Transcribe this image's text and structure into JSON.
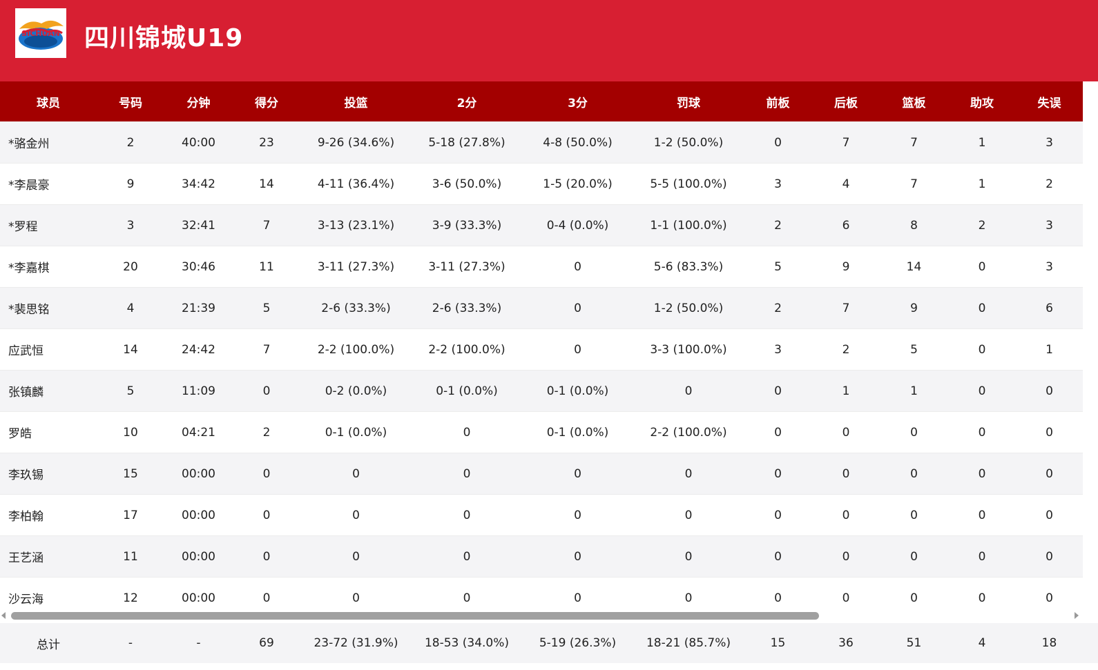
{
  "team": {
    "name": "四川锦城U19",
    "logo_text": "SICHUAN"
  },
  "colors": {
    "header_bg": "#d71f32",
    "table_header_bg": "#a30000",
    "row_alt_bg": "#f4f4f6"
  },
  "columns": [
    "球员",
    "号码",
    "分钟",
    "得分",
    "投篮",
    "2分",
    "3分",
    "罚球",
    "前板",
    "后板",
    "篮板",
    "助攻",
    "失误"
  ],
  "rows": [
    {
      "player": "*骆金州",
      "number": "2",
      "minutes": "40:00",
      "points": "23",
      "fg": "9-26 (34.6%)",
      "two": "5-18 (27.8%)",
      "three": "4-8 (50.0%)",
      "ft": "1-2 (50.0%)",
      "oreb": "0",
      "dreb": "7",
      "reb": "7",
      "ast": "1",
      "tov": "3"
    },
    {
      "player": "*李晨豪",
      "number": "9",
      "minutes": "34:42",
      "points": "14",
      "fg": "4-11 (36.4%)",
      "two": "3-6 (50.0%)",
      "three": "1-5 (20.0%)",
      "ft": "5-5 (100.0%)",
      "oreb": "3",
      "dreb": "4",
      "reb": "7",
      "ast": "1",
      "tov": "2"
    },
    {
      "player": "*罗程",
      "number": "3",
      "minutes": "32:41",
      "points": "7",
      "fg": "3-13 (23.1%)",
      "two": "3-9 (33.3%)",
      "three": "0-4 (0.0%)",
      "ft": "1-1 (100.0%)",
      "oreb": "2",
      "dreb": "6",
      "reb": "8",
      "ast": "2",
      "tov": "3"
    },
    {
      "player": "*李嘉棋",
      "number": "20",
      "minutes": "30:46",
      "points": "11",
      "fg": "3-11 (27.3%)",
      "two": "3-11 (27.3%)",
      "three": "0",
      "ft": "5-6 (83.3%)",
      "oreb": "5",
      "dreb": "9",
      "reb": "14",
      "ast": "0",
      "tov": "3"
    },
    {
      "player": "*裴思铭",
      "number": "4",
      "minutes": "21:39",
      "points": "5",
      "fg": "2-6 (33.3%)",
      "two": "2-6 (33.3%)",
      "three": "0",
      "ft": "1-2 (50.0%)",
      "oreb": "2",
      "dreb": "7",
      "reb": "9",
      "ast": "0",
      "tov": "6"
    },
    {
      "player": "应武恒",
      "number": "14",
      "minutes": "24:42",
      "points": "7",
      "fg": "2-2 (100.0%)",
      "two": "2-2 (100.0%)",
      "three": "0",
      "ft": "3-3 (100.0%)",
      "oreb": "3",
      "dreb": "2",
      "reb": "5",
      "ast": "0",
      "tov": "1"
    },
    {
      "player": "张镇麟",
      "number": "5",
      "minutes": "11:09",
      "points": "0",
      "fg": "0-2 (0.0%)",
      "two": "0-1 (0.0%)",
      "three": "0-1 (0.0%)",
      "ft": "0",
      "oreb": "0",
      "dreb": "1",
      "reb": "1",
      "ast": "0",
      "tov": "0"
    },
    {
      "player": "罗皓",
      "number": "10",
      "minutes": "04:21",
      "points": "2",
      "fg": "0-1 (0.0%)",
      "two": "0",
      "three": "0-1 (0.0%)",
      "ft": "2-2 (100.0%)",
      "oreb": "0",
      "dreb": "0",
      "reb": "0",
      "ast": "0",
      "tov": "0"
    },
    {
      "player": "李玖锡",
      "number": "15",
      "minutes": "00:00",
      "points": "0",
      "fg": "0",
      "two": "0",
      "three": "0",
      "ft": "0",
      "oreb": "0",
      "dreb": "0",
      "reb": "0",
      "ast": "0",
      "tov": "0"
    },
    {
      "player": "李柏翰",
      "number": "17",
      "minutes": "00:00",
      "points": "0",
      "fg": "0",
      "two": "0",
      "three": "0",
      "ft": "0",
      "oreb": "0",
      "dreb": "0",
      "reb": "0",
      "ast": "0",
      "tov": "0"
    },
    {
      "player": "王艺涵",
      "number": "11",
      "minutes": "00:00",
      "points": "0",
      "fg": "0",
      "two": "0",
      "three": "0",
      "ft": "0",
      "oreb": "0",
      "dreb": "0",
      "reb": "0",
      "ast": "0",
      "tov": "0"
    },
    {
      "player": "沙云海",
      "number": "12",
      "minutes": "00:00",
      "points": "0",
      "fg": "0",
      "two": "0",
      "three": "0",
      "ft": "0",
      "oreb": "0",
      "dreb": "0",
      "reb": "0",
      "ast": "0",
      "tov": "0"
    }
  ],
  "totals": {
    "player": "总计",
    "number": "-",
    "minutes": "-",
    "points": "69",
    "fg": "23-72 (31.9%)",
    "two": "18-53 (34.0%)",
    "three": "5-19 (26.3%)",
    "ft": "18-21 (85.7%)",
    "oreb": "15",
    "dreb": "36",
    "reb": "51",
    "ast": "4",
    "tov": "18"
  }
}
